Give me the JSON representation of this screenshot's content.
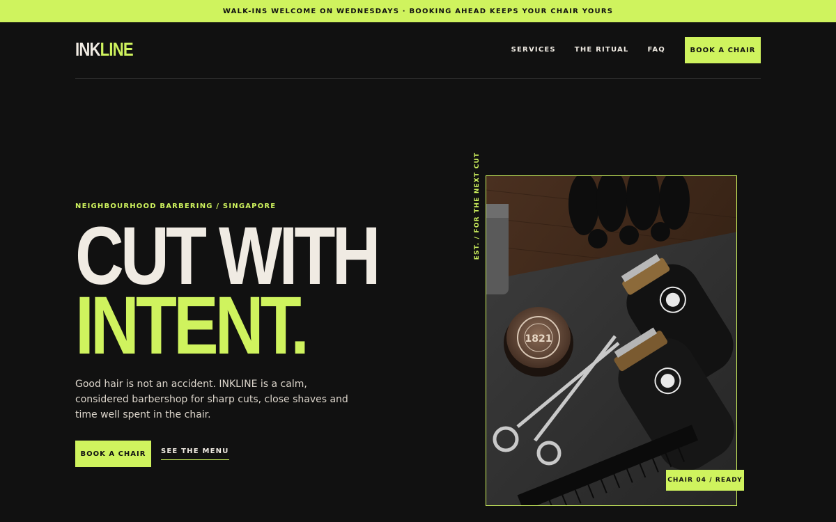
{
  "announcement": {
    "text": "WALK-INS WELCOME ON WEDNESDAYS · BOOKING AHEAD KEEPS YOUR CHAIR YOURS"
  },
  "brand": {
    "name_part1": "INK",
    "name_part2": "LINE"
  },
  "nav": {
    "links": [
      "SERVICES",
      "THE RITUAL",
      "FAQ"
    ],
    "cta": "BOOK A CHAIR"
  },
  "hero": {
    "eyebrow": "NEIGHBOURHOOD BARBERING / SINGAPORE",
    "headline_line1": "CUT WITH",
    "headline_line2": "INTENT.",
    "lede": "Good hair is not an accident. INKLINE is a calm, considered barbershop for sharp cuts, close shaves and time well spent in the chair.",
    "primary_cta": "BOOK A CHAIR",
    "secondary_cta": "SEE THE MENU"
  },
  "media": {
    "vertical_caption": "EST. / FOR THE NEXT CUT",
    "badge": "CHAIR 04 / READY",
    "tin_label": "1821"
  },
  "colors": {
    "accent": "#cff35e",
    "background": "#111111",
    "text": "#f0ebe3"
  }
}
